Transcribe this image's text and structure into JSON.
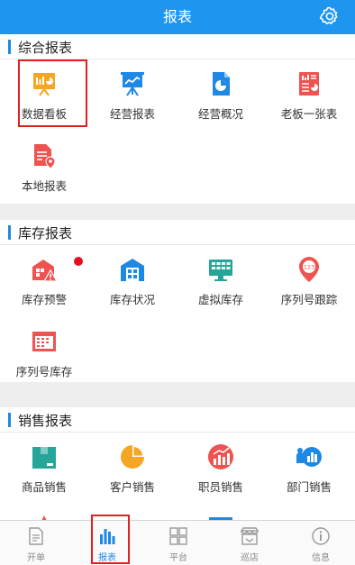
{
  "header": {
    "title": "报表",
    "settings_icon": "gear-icon"
  },
  "sections": [
    {
      "title": "综合报表",
      "items": [
        {
          "label": "数据看板",
          "icon": "dashboard-board-icon",
          "color": "#f5a623"
        },
        {
          "label": "经营报表",
          "icon": "presentation-chart-icon",
          "color": "#1e88e5"
        },
        {
          "label": "经营概况",
          "icon": "pie-document-icon",
          "color": "#1e88e5"
        },
        {
          "label": "老板一张表",
          "icon": "report-sheet-icon",
          "color": "#ef5350"
        },
        {
          "label": "本地报表",
          "icon": "location-document-icon",
          "color": "#ef5350"
        }
      ]
    },
    {
      "title": "库存报表",
      "items": [
        {
          "label": "库存预警",
          "icon": "warehouse-warning-icon",
          "color": "#ef5350",
          "badge": true
        },
        {
          "label": "库存状况",
          "icon": "warehouse-icon",
          "color": "#1e88e5"
        },
        {
          "label": "虚拟库存",
          "icon": "monitor-grid-icon",
          "color": "#26a69a"
        },
        {
          "label": "序列号跟踪",
          "icon": "serial-pin-icon",
          "color": "#ef5350",
          "pin_text": "123"
        },
        {
          "label": "序列号库存",
          "icon": "serial-table-icon",
          "color": "#ef5350"
        }
      ]
    },
    {
      "title": "销售报表",
      "items": [
        {
          "label": "商品销售",
          "icon": "product-box-icon",
          "color": "#26a69a"
        },
        {
          "label": "客户销售",
          "icon": "customer-pie-icon",
          "color": "#f5a623"
        },
        {
          "label": "职员销售",
          "icon": "staff-chart-icon",
          "color": "#ef5350"
        },
        {
          "label": "部门销售",
          "icon": "department-chart-icon",
          "color": "#1e88e5"
        }
      ]
    }
  ],
  "tabbar": [
    {
      "label": "开单",
      "icon": "document-icon"
    },
    {
      "label": "报表",
      "icon": "bar-chart-icon",
      "active": true
    },
    {
      "label": "平台",
      "icon": "grid-icon"
    },
    {
      "label": "巡店",
      "icon": "shop-icon"
    },
    {
      "label": "信息",
      "icon": "info-icon"
    }
  ],
  "colors": {
    "primary": "#1e96f0",
    "accent_blue": "#1e88e5",
    "badge_red": "#e8101e",
    "highlight_red": "#e0201e"
  }
}
